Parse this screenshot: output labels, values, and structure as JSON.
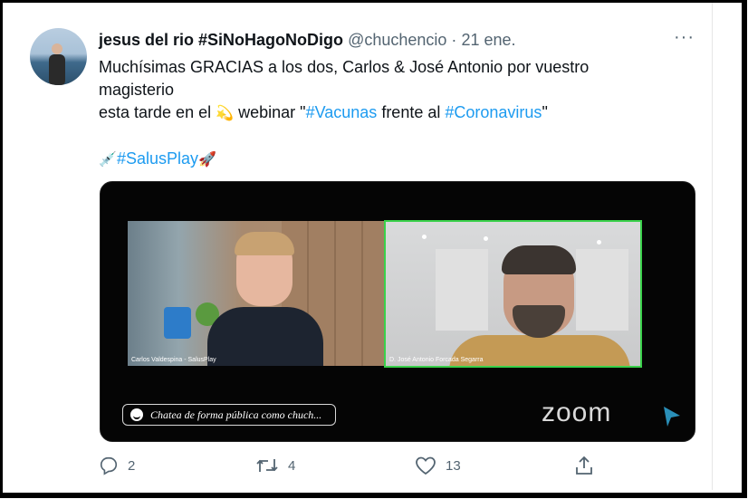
{
  "tweet": {
    "display_name": "jesus del rio #SiNoHagoNoDigo",
    "handle": "@chuchencio",
    "separator": "·",
    "date": "21 ene.",
    "more_glyph": "···",
    "text_line1": "Muchísimas GRACIAS a los dos, Carlos & José Antonio por vuestro",
    "text_line2": "magisterio",
    "text_line3_pre": "esta tarde en el",
    "text_line3_mid": "webinar \"",
    "hashtag_vacunas": "#Vacunas",
    "text_line3_frente": "frente al",
    "hashtag_coronavirus": "#Coronavirus",
    "text_line3_end": "\"",
    "hashtag_salusplay": "#SalusPlay",
    "emoji_dizzy": "💫",
    "emoji_syringe": "💉",
    "emoji_rocket": "🚀"
  },
  "media": {
    "participant1_label": "Carlos Valdespina - SalusPlay",
    "participant2_label": "D. José Antonio Forcada Segarra",
    "chat_placeholder": "Chatea de forma pública como chuch...",
    "zoom_logo": "zoom"
  },
  "actions": {
    "reply_count": "2",
    "retweet_count": "4",
    "like_count": "13"
  },
  "colors": {
    "link": "#1d9bf0",
    "secondary_text": "#536471",
    "active_speaker_border": "#3ad14b"
  }
}
